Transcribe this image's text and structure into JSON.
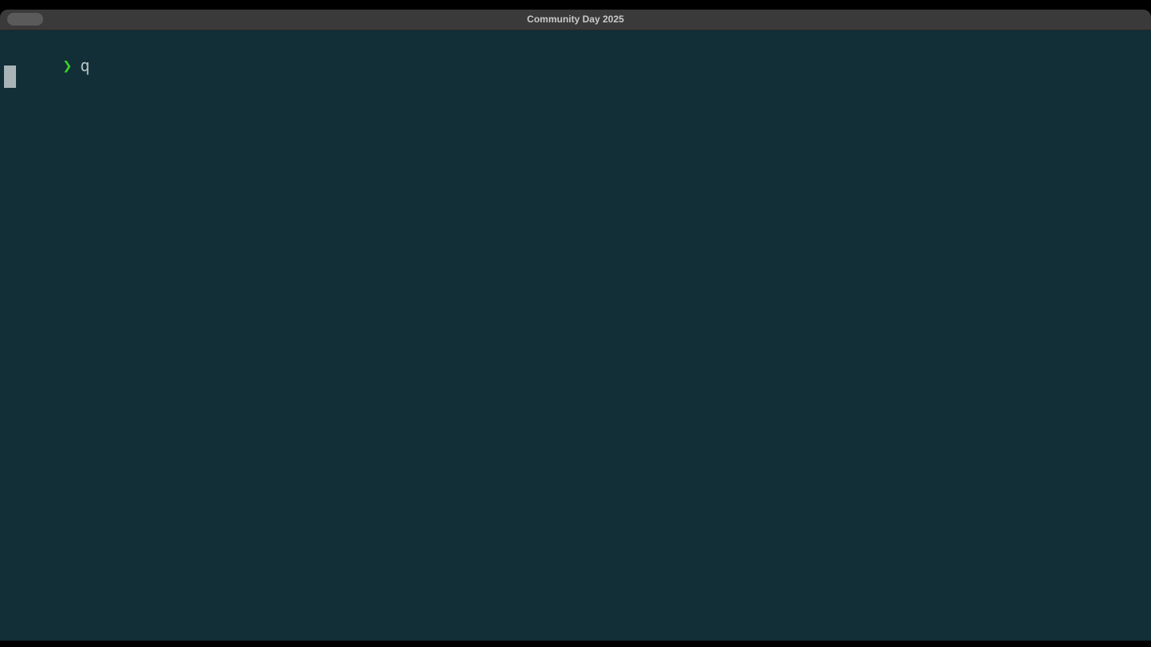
{
  "window": {
    "title": "Community Day 2025"
  },
  "terminal": {
    "prompt_symbol": "❯",
    "command": "q",
    "colors": {
      "background": "#122e36",
      "prompt": "#3bd12e",
      "text": "#b9c6c8",
      "cursor": "#a8b4b8"
    }
  }
}
